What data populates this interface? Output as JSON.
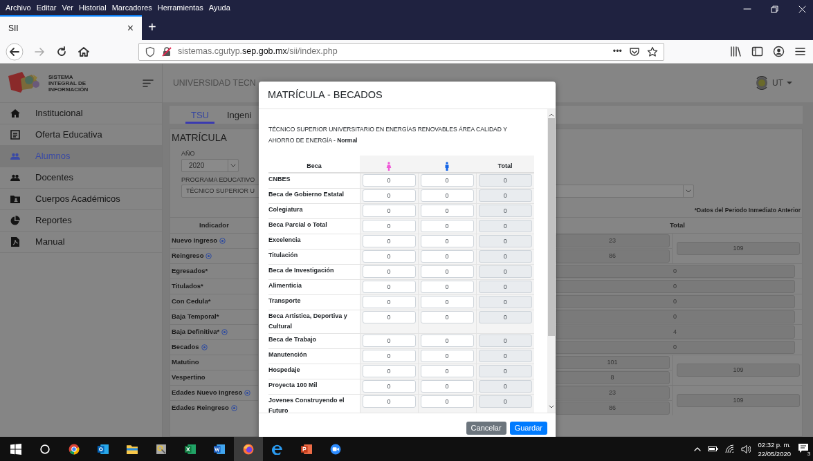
{
  "browser": {
    "menu": [
      "Archivo",
      "Editar",
      "Ver",
      "Historial",
      "Marcadores",
      "Herramientas",
      "Ayuda"
    ],
    "tabs": [
      {
        "title": "SII",
        "close": "×",
        "selected": true
      }
    ],
    "new_tab": "+",
    "url": "sistemas.cgutyp.**sep.gob.mx**/sii/index.php",
    "page_actions": "•••"
  },
  "app": {
    "brand": "SISTEMA INTEGRAL DE INFORMACIÓN",
    "header_title": "UNIVERSIDAD TECN",
    "user": "UT",
    "sidebar": [
      {
        "label": "Institucional",
        "kind": "home",
        "selected": false
      },
      {
        "label": "Oferta Educativa",
        "kind": "document",
        "selected": false
      },
      {
        "label": "Alumnos",
        "kind": "users",
        "selected": true
      },
      {
        "label": "Docentes",
        "kind": "users",
        "selected": false
      },
      {
        "label": "Cuerpos Académicos",
        "kind": "folder",
        "selected": false
      },
      {
        "label": "Reportes",
        "kind": "pie",
        "selected": false
      },
      {
        "label": "Manual",
        "kind": "pdf",
        "selected": false
      }
    ],
    "tabs": [
      {
        "label": "TSU",
        "selected": true
      },
      {
        "label": "Ingeni",
        "selected": false
      }
    ],
    "section_title": "MATRÍCULA",
    "year": {
      "label": "AÑO",
      "value": "2020"
    },
    "program": {
      "label": "PROGRAMA EDUCATIVO",
      "value": "TÉCNICO SUPERIOR U"
    },
    "note": "*Datos del Periodo Inmediato Anterior",
    "table": {
      "columns": [
        "Indicador",
        "Total"
      ],
      "groups": [
        {
          "rows": [
            {
              "label": "Nuevo Ingreso",
              "info": true,
              "value": "23"
            },
            {
              "label": "Reingreso",
              "info": true,
              "value": "86"
            }
          ],
          "subtotal": "109"
        },
        {
          "rows": [
            {
              "label": "Egresados*",
              "info": false,
              "value": "0"
            }
          ]
        },
        {
          "rows": [
            {
              "label": "Titulados*",
              "info": false,
              "value": "0"
            }
          ]
        },
        {
          "rows": [
            {
              "label": "Con Cedula*",
              "info": false,
              "value": "0"
            }
          ]
        },
        {
          "rows": [
            {
              "label": "Baja Temporal*",
              "info": false,
              "value": "0"
            }
          ]
        },
        {
          "rows": [
            {
              "label": "Baja Definitiva*",
              "info": true,
              "value": "4"
            }
          ]
        },
        {
          "rows": [
            {
              "label": "Becados",
              "info": true,
              "value": "0"
            }
          ]
        },
        {
          "rows": [
            {
              "label": "Matutino",
              "info": false,
              "value": "101"
            },
            {
              "label": "Vespertino",
              "info": false,
              "value": "8"
            }
          ],
          "subtotal": "109"
        },
        {
          "rows": [
            {
              "label": "Edades Nuevo Ingreso",
              "info": true,
              "value": "23"
            },
            {
              "label": "Edades Reingreso",
              "info": true,
              "value": "86"
            }
          ],
          "subtotal": "109"
        }
      ]
    }
  },
  "modal": {
    "title": "MATRÍCULA - BECADOS",
    "program": "TÉCNICO SUPERIOR UNIVERSITARIO EN ENERGÍAS RENOVABLES ÁREA CALIDAD Y AHORRO DE ENERGÍA - **Normal**",
    "columns": [
      {
        "kind": "text",
        "label": "Beca"
      },
      {
        "kind": "female"
      },
      {
        "kind": "male"
      },
      {
        "kind": "text",
        "label": "Total"
      }
    ],
    "rows": [
      {
        "name": "CNBES",
        "female": "0",
        "male": "0",
        "total": "0"
      },
      {
        "name": "Beca de Gobierno Estatal",
        "female": "0",
        "male": "0",
        "total": "0"
      },
      {
        "name": "Colegiatura",
        "female": "0",
        "male": "0",
        "total": "0"
      },
      {
        "name": "Beca Parcial o Total",
        "female": "0",
        "male": "0",
        "total": "0"
      },
      {
        "name": "Excelencia",
        "female": "0",
        "male": "0",
        "total": "0"
      },
      {
        "name": "Titulación",
        "female": "0",
        "male": "0",
        "total": "0"
      },
      {
        "name": "Beca de Investigación",
        "female": "0",
        "male": "0",
        "total": "0"
      },
      {
        "name": "Alimenticia",
        "female": "0",
        "male": "0",
        "total": "0"
      },
      {
        "name": "Transporte",
        "female": "0",
        "male": "0",
        "total": "0"
      },
      {
        "name": "Beca Artistica, Deportiva y Cultural",
        "female": "0",
        "male": "0",
        "total": "0"
      },
      {
        "name": "Beca de Trabajo",
        "female": "0",
        "male": "0",
        "total": "0"
      },
      {
        "name": "Manutención",
        "female": "0",
        "male": "0",
        "total": "0"
      },
      {
        "name": "Hospedaje",
        "female": "0",
        "male": "0",
        "total": "0"
      },
      {
        "name": "Proyecta 100 Mil",
        "female": "0",
        "male": "0",
        "total": "0"
      },
      {
        "name": "Jovenes Construyendo el Futuro",
        "female": "0",
        "male": "0",
        "total": "0"
      }
    ],
    "buttons": [
      {
        "label": "Cancelar",
        "kind": "secondary"
      },
      {
        "label": "Guardar",
        "kind": "primary"
      }
    ]
  },
  "taskbar": {
    "apps": [
      {
        "kind": "start",
        "selected": false
      },
      {
        "kind": "search",
        "selected": false
      },
      {
        "kind": "chrome",
        "selected": false
      },
      {
        "kind": "mail",
        "selected": false
      },
      {
        "kind": "folder",
        "selected": false
      },
      {
        "kind": "app",
        "selected": false
      },
      {
        "kind": "sheet",
        "selected": false
      },
      {
        "kind": "doc",
        "selected": false
      },
      {
        "kind": "firefox",
        "selected": true
      },
      {
        "kind": "edge",
        "selected": false
      },
      {
        "kind": "slides",
        "selected": false
      },
      {
        "kind": "video",
        "selected": false
      }
    ],
    "time": "02:32 p. m.",
    "date": "22/05/2020",
    "notifications": "3"
  }
}
